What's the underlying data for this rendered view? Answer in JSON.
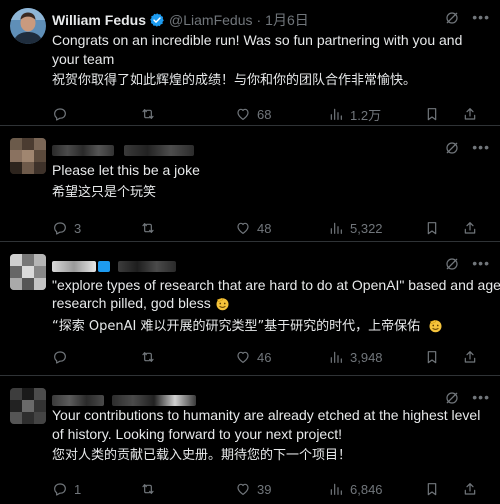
{
  "tweets": [
    {
      "name": "William Fedus",
      "handle": "@LiamFedus",
      "separator": "·",
      "date": "1月6日",
      "text_en": "Congrats on an incredible run! Was so fun partnering with you and your team",
      "text_zh": "祝贺你取得了如此辉煌的成绩！与你和你的团队合作非常愉快。",
      "replies": "",
      "retweets": "",
      "likes": "68",
      "views": "1.2万"
    },
    {
      "name": "",
      "handle": "",
      "text_en": "Please let this be a joke",
      "text_zh": "希望这只是个玩笑",
      "replies": "3",
      "retweets": "",
      "likes": "48",
      "views": "5,322"
    },
    {
      "name": "",
      "handle": "",
      "text_en_1": "\"explore types of research that are hard to do at OpenAI\" based and age of",
      "text_en_2": "research pilled, god bless",
      "text_zh": "“探索 OpenAI 难以开展的研究类型”基于研究的时代，上帝保佑",
      "replies": "",
      "retweets": "",
      "likes": "46",
      "views": "3,948"
    },
    {
      "name": "",
      "handle": "",
      "text_en": "Your contributions to humanity are already etched at the highest level of history. Looking forward to your next project!",
      "text_zh": "您对人类的贡献已载入史册。期待您的下一个项目！",
      "replies": "1",
      "retweets": "",
      "likes": "39",
      "views": "6,846"
    }
  ],
  "colors": {
    "background": "#000000",
    "text": "#e7e9ea",
    "muted": "#71767b",
    "border": "#2f3336",
    "verified": "#1d9bf0"
  },
  "icons": {
    "reply": "speech-bubble-icon",
    "retweet": "retweet-arrows-icon",
    "like": "heart-icon",
    "views": "bar-chart-icon",
    "bookmark": "bookmark-icon",
    "share": "share-upload-icon",
    "grok": "grok-slash-icon",
    "more": "ellipsis-icon"
  }
}
